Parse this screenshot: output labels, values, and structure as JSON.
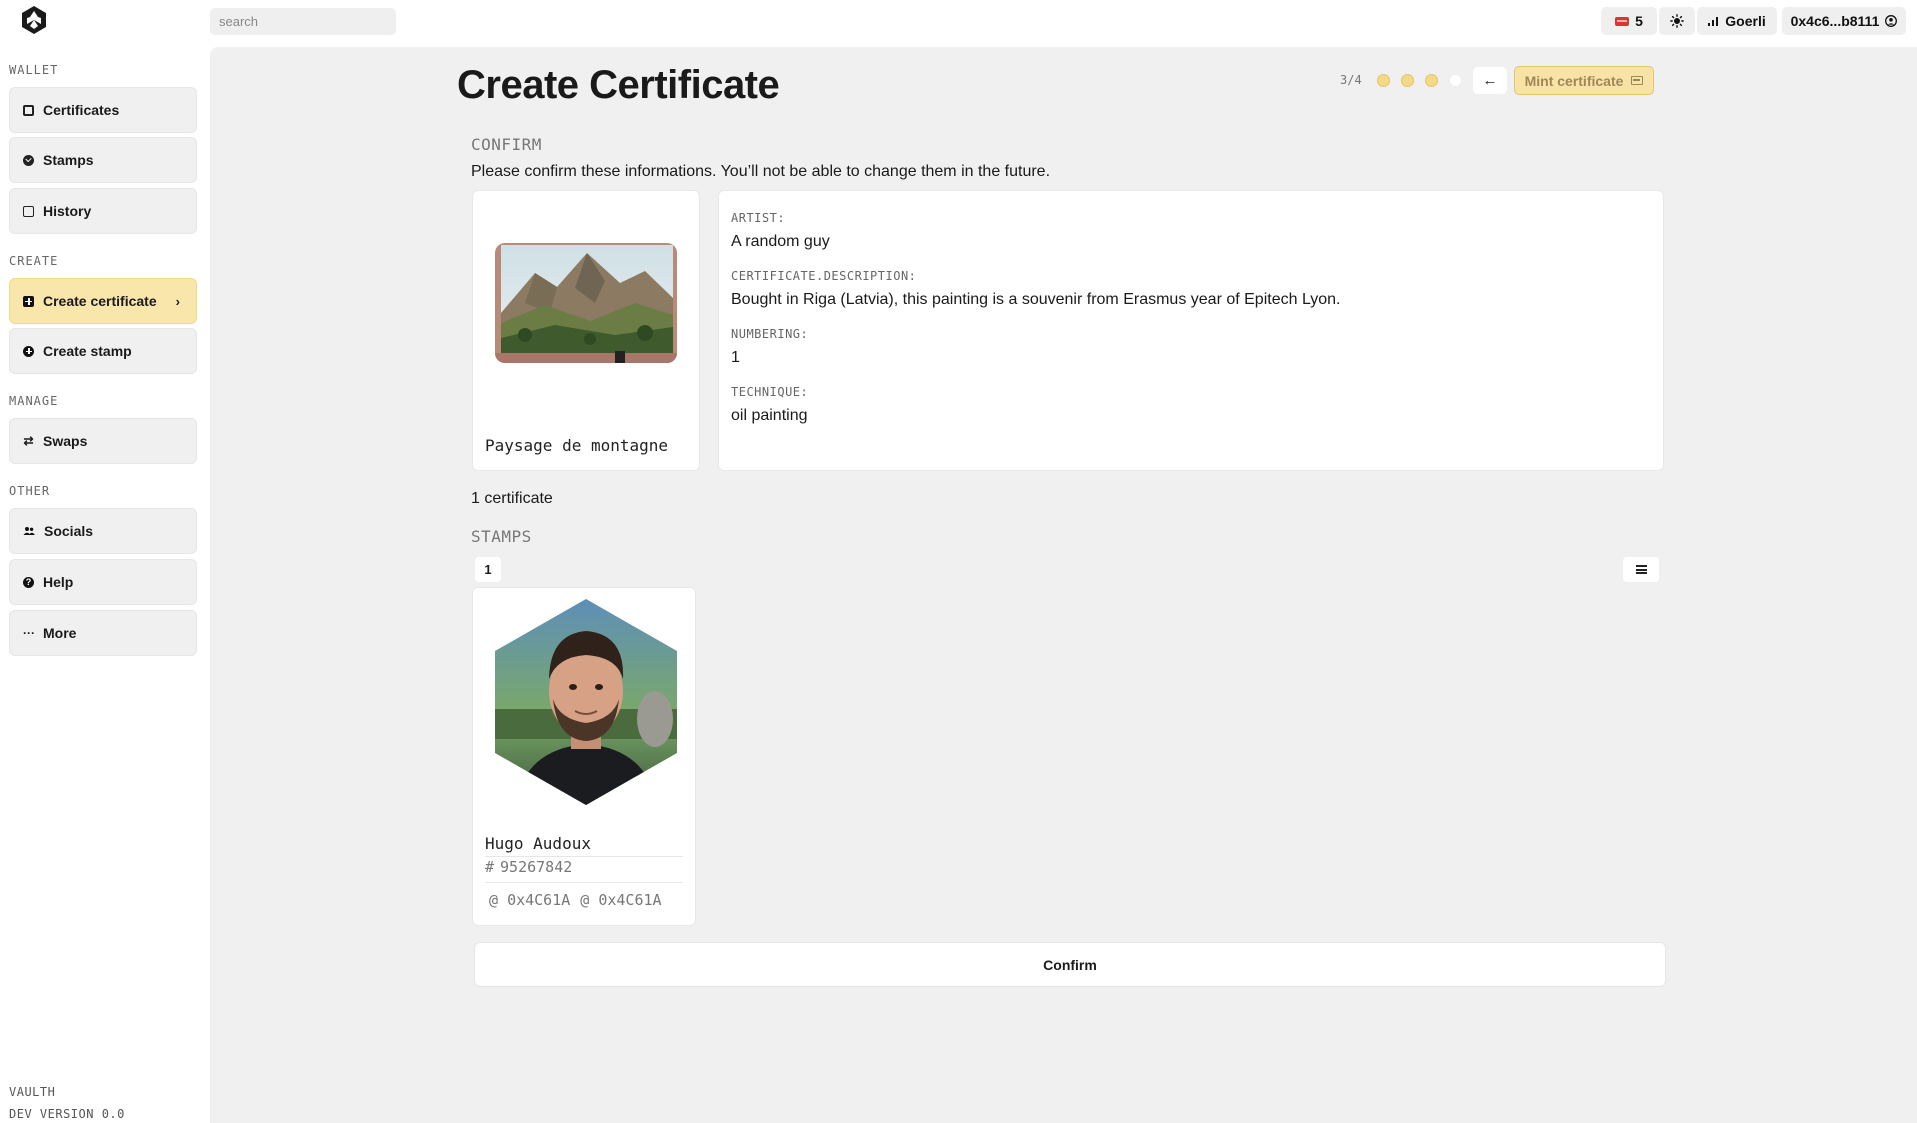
{
  "topbar": {
    "search_placeholder": "search",
    "notification_count": "5",
    "network": "Goerli",
    "account": "0x4c6...b8111"
  },
  "sidebar": {
    "sections": {
      "wallet": "WALLET",
      "create": "CREATE",
      "manage": "MANAGE",
      "other": "OTHER"
    },
    "items": {
      "certificates": "Certificates",
      "stamps": "Stamps",
      "history": "History",
      "create_certificate": "Create certificate",
      "create_stamp": "Create stamp",
      "swaps": "Swaps",
      "socials": "Socials",
      "help": "Help",
      "more": "More"
    },
    "active_item": "create_certificate",
    "footer": {
      "name": "VAULTH",
      "version": "DEV VERSION 0.0"
    }
  },
  "main": {
    "title": "Create Certificate",
    "step": "3/4",
    "steps_total": 4,
    "steps_done": 3,
    "mint_label": "Mint certificate",
    "confirm_heading": "CONFIRM",
    "confirm_text": "Please confirm these informations. You’ll not be able to change them in the future.",
    "artwork": {
      "title": "Paysage de montagne"
    },
    "info": {
      "artist_label": "ARTIST:",
      "artist_value": "A random guy",
      "description_label": "CERTIFICATE.DESCRIPTION:",
      "description_value": "Bought in Riga (Latvia), this painting is a souvenir from Erasmus year of Epitech Lyon.",
      "numbering_label": "NUMBERING:",
      "numbering_value": "1",
      "technique_label": "TECHNIQUE:",
      "technique_value": "oil painting"
    },
    "certificate_count": "1 certificate",
    "stamps_heading": "STAMPS",
    "stamp_count": "1",
    "stamp": {
      "name": "Hugo Audoux",
      "id_prefix": "#",
      "id": "95267842",
      "addresses": [
        "0x4C61A",
        "0x4C61A"
      ],
      "address_prefix": "@"
    },
    "confirm_button": "Confirm"
  },
  "colors": {
    "accent": "#f9e6ab",
    "accent_border": "#e6c66d",
    "background": "#f0f0f0"
  }
}
